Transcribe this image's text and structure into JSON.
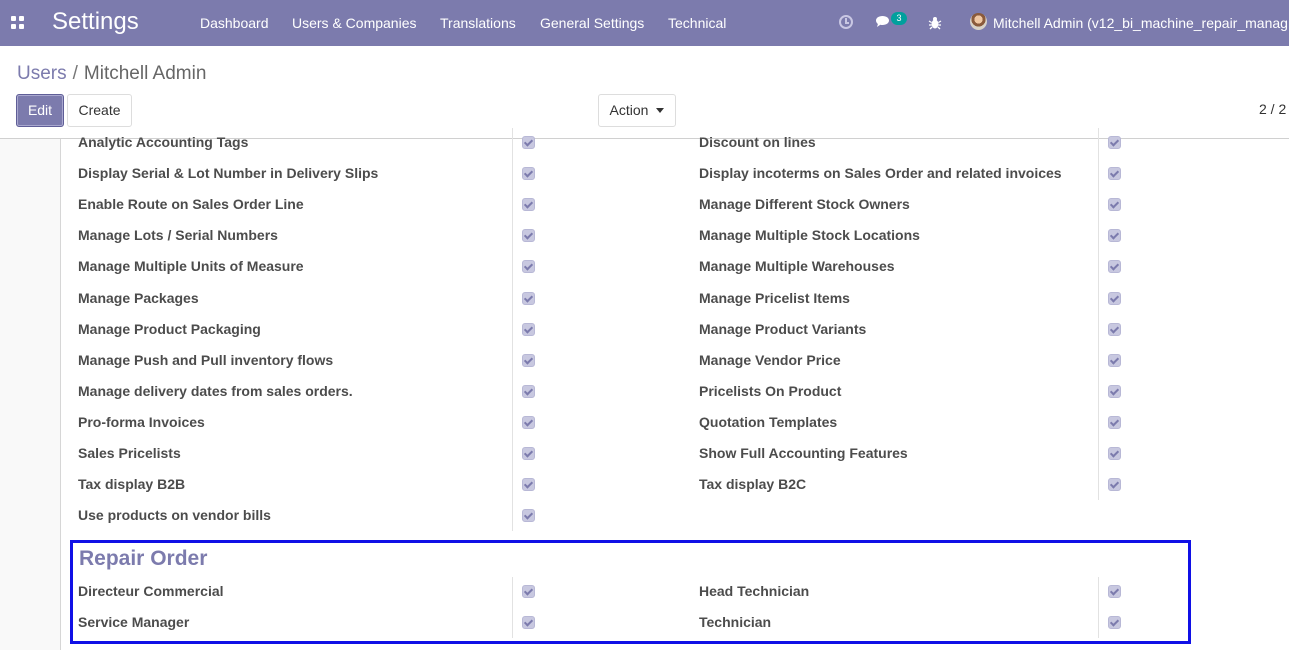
{
  "navbar": {
    "app_title": "Settings",
    "menu": [
      "Dashboard",
      "Users & Companies",
      "Translations",
      "General Settings",
      "Technical"
    ],
    "chat_count": "3",
    "user": "Mitchell Admin (v12_bi_machine_repair_manag"
  },
  "breadcrumb": {
    "parent": "Users",
    "separator": "/",
    "current": "Mitchell Admin"
  },
  "buttons": {
    "edit": "Edit",
    "create": "Create",
    "action": "Action"
  },
  "pager": "2 / 2",
  "rights": {
    "left": [
      {
        "label": "Analytic Accounting Tags",
        "checked": true
      },
      {
        "label": "Display Serial & Lot Number in Delivery Slips",
        "checked": true
      },
      {
        "label": "Enable Route on Sales Order Line",
        "checked": true
      },
      {
        "label": "Manage Lots / Serial Numbers",
        "checked": true
      },
      {
        "label": "Manage Multiple Units of Measure",
        "checked": true
      },
      {
        "label": "Manage Packages",
        "checked": true
      },
      {
        "label": "Manage Product Packaging",
        "checked": true
      },
      {
        "label": "Manage Push and Pull inventory flows",
        "checked": true
      },
      {
        "label": "Manage delivery dates from sales orders.",
        "checked": true
      },
      {
        "label": "Pro-forma Invoices",
        "checked": true
      },
      {
        "label": "Sales Pricelists",
        "checked": true
      },
      {
        "label": "Tax display B2B",
        "checked": true
      },
      {
        "label": "Use products on vendor bills",
        "checked": true
      }
    ],
    "right": [
      {
        "label": "Discount on lines",
        "checked": true
      },
      {
        "label": "Display incoterms on Sales Order and related invoices",
        "checked": true
      },
      {
        "label": "Manage Different Stock Owners",
        "checked": true
      },
      {
        "label": "Manage Multiple Stock Locations",
        "checked": true
      },
      {
        "label": "Manage Multiple Warehouses",
        "checked": true
      },
      {
        "label": "Manage Pricelist Items",
        "checked": true
      },
      {
        "label": "Manage Product Variants",
        "checked": true
      },
      {
        "label": "Manage Vendor Price",
        "checked": true
      },
      {
        "label": "Pricelists On Product",
        "checked": true
      },
      {
        "label": "Quotation Templates",
        "checked": true
      },
      {
        "label": "Show Full Accounting Features",
        "checked": true
      },
      {
        "label": "Tax display B2C",
        "checked": true
      }
    ]
  },
  "repair_order": {
    "title": "Repair Order",
    "left": [
      {
        "label": "Directeur Commercial",
        "checked": true
      },
      {
        "label": "Service Manager",
        "checked": true
      }
    ],
    "right": [
      {
        "label": "Head Technician",
        "checked": true
      },
      {
        "label": "Technician",
        "checked": true
      }
    ]
  },
  "colors": {
    "brand": "#7c7bad",
    "highlight": "#1010e6",
    "badge": "#00a09d"
  }
}
